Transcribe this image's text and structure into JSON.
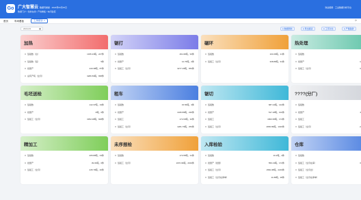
{
  "header": {
    "logo": "Go",
    "brand": "广大智慧云",
    "version": "数据驾驶舱 · 2024年03月15日",
    "meta": "数据门户 / 当前在线 / 产线看板 / 车间监控",
    "right": "欢迎使用 · 工业数据分析平台"
  },
  "tabs": {
    "home": "首页",
    "t1": "车间看板",
    "active": "工序统计 ×",
    "ctrl": "⟳"
  },
  "toolbar": {
    "date": "2024-03",
    "buttons": [
      "● 数据刷新",
      "● 导出报表",
      "● 工序对比",
      "● 产量趋势"
    ]
  },
  "cards": [
    {
      "title": "加热",
      "color": "#f26d6d",
      "rows": [
        [
          "班组数（台）",
          "1335.23吨，227件"
        ],
        [
          "班组数（班）",
          "5件"
        ],
        [
          "批量产",
          "440.38吨，87件"
        ],
        [
          "总有产吨（全月）",
          "3286.59吨，658件"
        ]
      ]
    },
    {
      "title": "锯打",
      "color": "#7b7ce8",
      "rows": [
        [
          "班组数",
          "461.82吨，93件"
        ],
        [
          "批量产",
          "12.76吨，2件"
        ],
        [
          "班组工（全月）",
          "3277.29吨，653件"
        ]
      ]
    },
    {
      "title": "碾环",
      "color": "#f0a13a",
      "rows": [
        [
          "班组数",
          "103.26吨，21件"
        ],
        [
          "班组工（全月）",
          "338.89吨，91件"
        ]
      ]
    },
    {
      "title": "热处理",
      "color": "#60c4a8",
      "rows": [
        [
          "班组数",
          "205.89吨"
        ],
        [
          "批量产",
          "1005.55吨"
        ],
        [
          "班组工（全月）",
          "3155.29吨"
        ]
      ]
    },
    {
      "title": "毛坯送检",
      "color": "#7fce5a",
      "rows": [
        [
          "班组数",
          "142.37吨，19件"
        ],
        [
          "批量产",
          "0吨，0件"
        ],
        [
          "班组工（全月）",
          "3352.08吨，608件"
        ]
      ]
    },
    {
      "title": "粗车",
      "color": "#4b7fe0",
      "rows": [
        [
          "班组数",
          "15.56吨，3件"
        ],
        [
          "批量产",
          "1045.89吨，220件"
        ],
        [
          "班组工",
          "172.63吨，32件"
        ],
        [
          "班组工（全月）",
          "1281.79吨，253件"
        ]
      ]
    },
    {
      "title": "锯切",
      "color": "#3fb8d8",
      "rows": [
        [
          "班组数",
          "687.24吨，142件"
        ],
        [
          "批量产",
          "517.18吨，102件"
        ],
        [
          "班组工",
          "1800.95吨，174件"
        ],
        [
          "班组工（全月）",
          "4656.89吨，1016件"
        ]
      ]
    },
    {
      "title": "????(分厂)",
      "color": "#d0d3d9",
      "rows": [
        [
          "班组数",
          "325.47吨"
        ],
        [
          "批量产",
          "4114.53吨"
        ],
        [
          "班组工",
          "320.39吨"
        ],
        [
          "班组工（全月）",
          "2496.89吨"
        ]
      ]
    },
    {
      "title": "精加工",
      "color": "#7fce5a",
      "rows": [
        [
          "班组数",
          "205.89吨，23件"
        ],
        [
          "批量产",
          "39.03吨，0件"
        ],
        [
          "班组工（全月）",
          "245.79吨，40件"
        ]
      ]
    },
    {
      "title": "未序报检",
      "color": "#f0a13a",
      "rows": [
        [
          "班组数",
          "173.55吨，21件"
        ],
        [
          "班组工（全月）",
          "1976.09吨，2019件"
        ]
      ]
    },
    {
      "title": "入库检验",
      "color": "#3fb8d8",
      "rows": [
        [
          "班组数",
          "10.2吨，4件"
        ],
        [
          "批量产（批量）",
          "559.13吨，172件"
        ],
        [
          "班组工（全月）",
          "1582.08吨，2219件"
        ],
        [
          "班组工（全月在库单）",
          "11.89吨，28件"
        ]
      ]
    },
    {
      "title": "仓库",
      "color": "#4b7fe0",
      "rows": [
        [
          "班组数",
          "17.5吨"
        ],
        [
          "班组工（全月在库）",
          "3953.97吨"
        ],
        [
          "班组工（全月出）",
          "205.89吨"
        ],
        [
          "班组工（全月在库单）",
          "11.89吨"
        ]
      ]
    }
  ]
}
